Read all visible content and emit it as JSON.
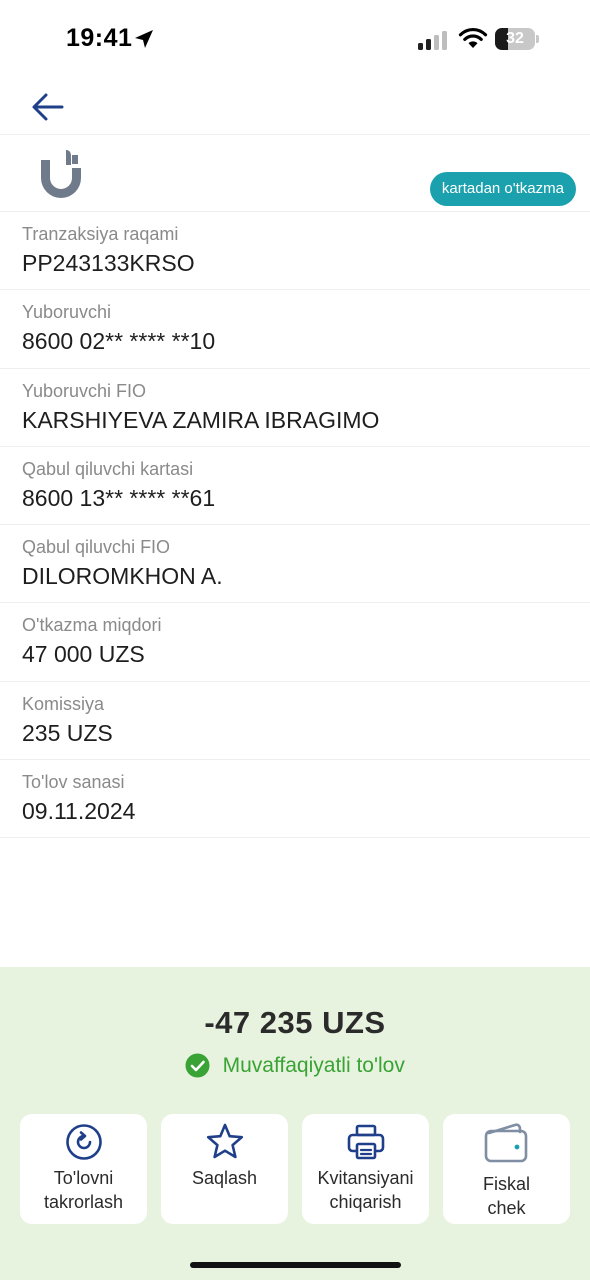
{
  "status_bar": {
    "time": "19:41",
    "battery_level": "32",
    "icons": [
      "location-arrow-icon",
      "cellular-signal-icon",
      "wifi-icon",
      "battery-icon"
    ]
  },
  "nav": {
    "back_icon": "arrow-left-icon"
  },
  "brand": {
    "logo_icon": "bank-logo-icon",
    "badge_label": "kartadan o'tkazma"
  },
  "details": [
    {
      "label": "Tranzaksiya raqami",
      "value": "PP243133KRSO"
    },
    {
      "label": "Yuboruvchi",
      "value": "8600 02** **** **10"
    },
    {
      "label": "Yuboruvchi FIO",
      "value": "KARSHIYEVA ZAMIRA IBRAGIMO"
    },
    {
      "label": "Qabul qiluvchi kartasi",
      "value": "8600 13** **** **61"
    },
    {
      "label": "Qabul qiluvchi FIO",
      "value": "DILOROMKHON A."
    },
    {
      "label": "O'tkazma miqdori",
      "value": "47 000 UZS"
    },
    {
      "label": "Komissiya",
      "value": "235 UZS"
    },
    {
      "label": "To'lov sanasi",
      "value": "09.11.2024"
    }
  ],
  "summary": {
    "amount": "-47 235 UZS",
    "status": "Muvaffaqiyatli to'lov",
    "status_icon": "check-circle-icon"
  },
  "actions": [
    {
      "line1": "To'lovni",
      "line2": "takrorlash",
      "icon": "repeat-icon"
    },
    {
      "line1": "Saqlash",
      "line2": "",
      "icon": "star-icon"
    },
    {
      "line1": "Kvitansiyani",
      "line2": "chiqarish",
      "icon": "printer-icon"
    },
    {
      "line1": "Fiskal",
      "line2": "chek",
      "icon": "wallet-icon"
    }
  ],
  "colors": {
    "accent_blue": "#1f3f8a",
    "badge_teal": "#1aa1ad",
    "success_green": "#3aa335",
    "panel_bg": "#e8f3df"
  }
}
